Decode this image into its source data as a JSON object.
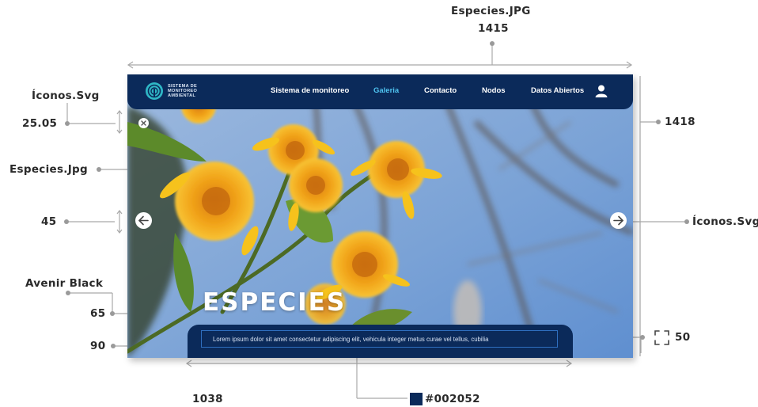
{
  "annotations": {
    "top_file": "Especies.JPG",
    "top_width": "1415",
    "icons_left": "Íconos.Svg",
    "icons_left_size": "25.05",
    "image_left": "Especies.Jpg",
    "arrow_size": "45",
    "font_name": "Avenir Black",
    "title_size": "65",
    "caption_height": "90",
    "right_height": "1418",
    "icons_right": "Íconos.Svg",
    "bracket_size": "50",
    "bottom_width": "1038",
    "color_hex": "#002052"
  },
  "mockup": {
    "nav": {
      "brand_line1": "SISTEMA DE",
      "brand_line2": "MONITOREO",
      "brand_line3": "AMBIENTAL",
      "items": [
        "Sistema de monitoreo",
        "Galeria",
        "Contacto",
        "Nodos",
        "Datos Abiertos"
      ],
      "active_item": "Galeria"
    },
    "title": "ESPECIES",
    "caption": "Lorem ipsum dolor sit amet consectetur adipiscing elit, vehicula integer metus curae vel tellus, cubilia",
    "colors": {
      "nav_bg": "#0b2a5a",
      "accent": "#4fc3f0",
      "swatch": "#002052"
    },
    "icons": [
      "logo-icon",
      "user-icon",
      "close-icon",
      "arrow-left-icon",
      "arrow-right-icon",
      "fullscreen-bracket-icon"
    ]
  }
}
